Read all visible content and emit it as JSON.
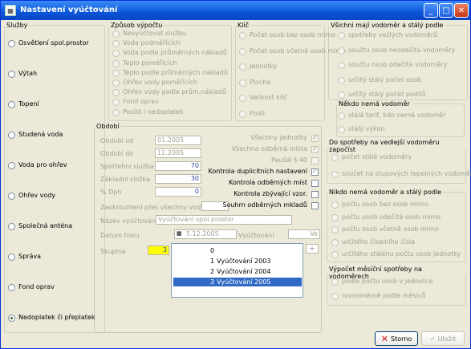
{
  "window": {
    "title": "Nastavení vyúčtování"
  },
  "sluzby": {
    "legend": "Služby",
    "items": [
      "Osvětlení spol.prostor",
      "Výtah",
      "Topení",
      "Studená voda",
      "Voda pro ohřev",
      "Ohřev vody",
      "Společná anténa",
      "Správa",
      "Fond oprav",
      "Nedoplatek či přeplatek"
    ]
  },
  "zpusob": {
    "legend": "Způsob výpočtu",
    "items": [
      "Nevyúčtovat službu",
      "Voda podměřících",
      "Voda podle průměrných nákladů",
      "Teplo poměřících",
      "Teplo podle průměrných nákladů",
      "Ohřev vody poměřících",
      "Ohřev vody podle prům.nákladů",
      "Fond oprav",
      "Posílit i nedoplatek"
    ]
  },
  "kli": {
    "legend": "Klíč",
    "items": [
      "Počet osob bez osob mimo",
      "Počet osob včetně osob mimo",
      "Jednotky",
      "Plocha",
      "Velikost klíč",
      "Podíl"
    ]
  },
  "vsechny": {
    "legend": "Všichni mají vodoměr a stálý podle",
    "items": [
      "spotřeby vešlých vodoměrů",
      "součtu osob neodečítá vodoměry",
      "součtu osob odečítá vodoměry",
      "určitý stálý počet osob",
      "určitý stálý počet podílů"
    ]
  },
  "nekdo": {
    "legend": "Někdo nemá vodoměr",
    "items": [
      "stálá tarif, kdo nemá vodoměr",
      "stálý výkon"
    ]
  },
  "obdobi": {
    "legend": "Období",
    "od_label": "Období od",
    "od_value": "01.2005",
    "do_label": "Období do",
    "do_value": "12.2005",
    "spotrebni_label": "Spotřební služba",
    "spotrebni_value": "70",
    "zakladni_label": "Základní složka",
    "zakladni_value": "30",
    "dph_label": "% Dph",
    "dph_value": "0",
    "zaokrouhleni_label": "Zaokrouhlení přes všechny vody",
    "nazev_label": "Název vyúčtování",
    "nazev_value": "Vyúčtování spol.prostor",
    "datum_label": "Datum tisku",
    "datum_value": "5.12.2005",
    "vyuctovani_label": "Vyúčtování",
    "vyuctovani_value": "Ve",
    "skupina_label": "Skupina",
    "skupina_value": "3"
  },
  "checks": {
    "vsechny_jednotky": "Všechny jednotky",
    "vsechna_mista": "Všechna odběrná místa",
    "pausal": "Paušál § 40",
    "kontrola_dupl": "Kontrola duplicitních nastavení",
    "kontrola_odber": "Kontrola odběrných míst",
    "kontrola_zbyt": "Kontrola zbývající vzor.",
    "souhrn": "Souhrn odběrných mkladů"
  },
  "skupiny_list": [
    {
      "num": "0",
      "label": ""
    },
    {
      "num": "1",
      "label": "Vyúčtování 2003"
    },
    {
      "num": "2",
      "label": "Vyúčtování 2004"
    },
    {
      "num": "3",
      "label": "Vyúčtování 2005"
    }
  ],
  "do_spotreby": {
    "legend": "Do spotřeby na vedlejší vodoměru započíst",
    "items": [
      "počet stálé vodoměry",
      "součet na stupových tepelných vodoměru"
    ]
  },
  "nikdo": {
    "legend": "Nikdo nemá vodoměr a stálý podle",
    "items": [
      "počtu osob bez osob mimo",
      "počtu osob odečítá osob mimo",
      "počtu osob včetně osob mimo",
      "určitého číselního čísla",
      "určitého stálého počtu osob jednotky"
    ]
  },
  "mesicni": {
    "legend": "Výpočet měsíční spotřeby na vodoměrech",
    "items": [
      "podle počtu osob v jednotce",
      "rovnoměrně podle měsíců"
    ]
  },
  "buttons": {
    "close": "Storno",
    "save": "Uložit"
  }
}
